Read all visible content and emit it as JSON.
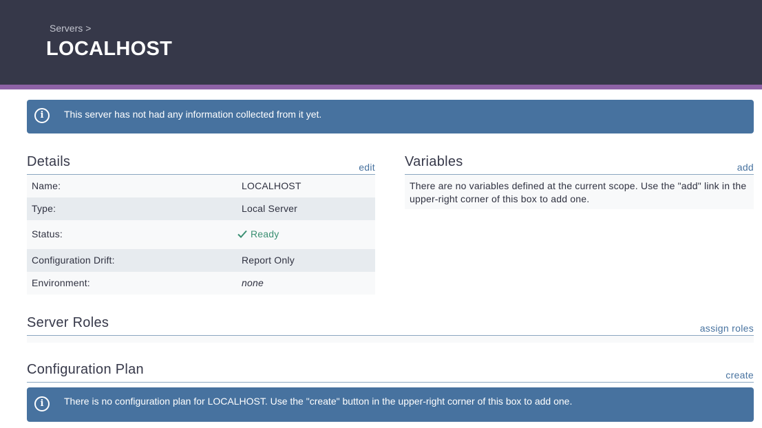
{
  "header": {
    "breadcrumb": "Servers",
    "breadcrumb_sep": ">",
    "title": "LOCALHOST"
  },
  "alerts": {
    "no_info": "This server has not had any information collected from it yet.",
    "no_plan": "There is no configuration plan for LOCALHOST. Use the \"create\" button in the upper-right corner of this box to add one.",
    "icon": "info-icon",
    "icon_glyph": "i"
  },
  "details": {
    "title": "Details",
    "link": "edit",
    "rows": [
      {
        "label": "Name:",
        "value": "LOCALHOST"
      },
      {
        "label": "Type:",
        "value": "Local Server"
      },
      {
        "label": "Status:",
        "value": "Ready",
        "icon": "check-icon"
      },
      {
        "label": "Configuration Drift:",
        "value": "Report Only"
      },
      {
        "label": "Environment:",
        "value": "none"
      }
    ]
  },
  "variables": {
    "title": "Variables",
    "link": "add",
    "empty_text": "There are no variables defined at the current scope. Use the \"add\" link in the upper-right corner of this box to add one."
  },
  "server_roles": {
    "title": "Server Roles",
    "link": "assign roles"
  },
  "configuration_plan": {
    "title": "Configuration Plan",
    "link": "create"
  },
  "colors": {
    "header_bg": "#363849",
    "accent_stripe": "#8e62a6",
    "alert_bg": "#47729f",
    "link": "#47729f",
    "status_ready": "#3a8f72"
  }
}
